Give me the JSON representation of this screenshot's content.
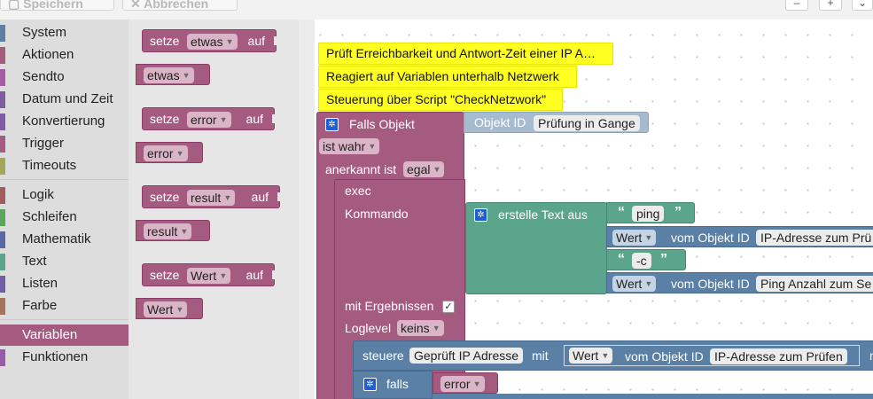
{
  "topbar": {
    "btn1_label": "Speichern",
    "btn2_label": "Abbrechen",
    "icon1": "minus-icon",
    "icon2": "plus-icon",
    "icon3": "chevron-down-icon"
  },
  "toolbox": {
    "categories": [
      {
        "label": "System",
        "color": "#5b80a5"
      },
      {
        "label": "Aktionen",
        "color": "#a55b80"
      },
      {
        "label": "Sendto",
        "color": "#a55ba5"
      },
      {
        "label": "Datum und Zeit",
        "color": "#805ba5"
      },
      {
        "label": "Konvertierung",
        "color": "#805ba5"
      },
      {
        "label": "Trigger",
        "color": "#a55b80"
      },
      {
        "label": "Timeouts",
        "color": "#a5a55b"
      },
      {
        "label": "Logik",
        "color": "#a55b5b"
      },
      {
        "label": "Schleifen",
        "color": "#5ba55b"
      },
      {
        "label": "Mathematik",
        "color": "#5b67a5"
      },
      {
        "label": "Text",
        "color": "#5ba58c"
      },
      {
        "label": "Listen",
        "color": "#745ba5"
      },
      {
        "label": "Farbe",
        "color": "#a5745b"
      },
      {
        "label": "Variablen",
        "color": "#a55b80",
        "selected": true
      },
      {
        "label": "Funktionen",
        "color": "#995ba5"
      }
    ]
  },
  "flyout": {
    "setters": [
      {
        "prefix": "setze",
        "var": "etwas",
        "suffix": "auf"
      },
      {
        "prefix": "setze",
        "var": "error",
        "suffix": "auf"
      },
      {
        "prefix": "setze",
        "var": "result",
        "suffix": "auf"
      },
      {
        "prefix": "setze",
        "var": "Wert",
        "suffix": "auf"
      }
    ],
    "getters": [
      "etwas",
      "error",
      "result",
      "Wert"
    ]
  },
  "workspace": {
    "comments": [
      "Prüft Erreichbarkeit und Antwort-Zeit einer IP A…",
      "Reagiert auf Variablen unterhalb Netzwerk",
      "Steuerung über Script \"CheckNetzwork\""
    ],
    "trigger": {
      "label": "Falls Objekt",
      "object_id_label": "Objekt ID",
      "object_id_value": "Prüfung in Gange",
      "condition": "ist wahr",
      "ack_label": "anerkannt ist",
      "ack_value": "egal"
    },
    "exec": {
      "label": "exec",
      "command_label": "Kommando",
      "create_text_label": "erstelle Text aus",
      "text1": "ping",
      "value1_dd": "Wert",
      "value1_mid": "vom Objekt ID",
      "value1_id": "IP-Adresse zum Prü",
      "text2": "-c",
      "value2_dd": "Wert",
      "value2_mid": "vom Objekt ID",
      "value2_id": "Ping Anzahl zum Se",
      "results_label": "mit Ergebnissen",
      "results_checked": "✓",
      "loglevel_label": "Loglevel",
      "loglevel_value": "keins"
    },
    "control": {
      "label": "steuere",
      "target": "Geprüft IP Adresse",
      "with": "mit",
      "value_dd": "Wert",
      "value_mid": "vom Objekt ID",
      "value_id": "IP-Adresse zum Prüfen",
      "trailing": "n"
    },
    "if_block": {
      "label": "falls",
      "var": "error"
    }
  }
}
